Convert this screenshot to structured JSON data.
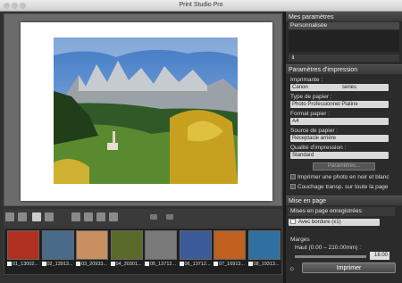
{
  "window": {
    "title": "Print Studio Pro"
  },
  "settings_panel": {
    "header": "Mes paramètres",
    "selected_preset": "Personnalisée"
  },
  "print_settings": {
    "header": "Paramètres d'impression",
    "printer_label": "Imprimante :",
    "printer_value_left": "Canon",
    "printer_value_right": "series",
    "paper_type_label": "Type de papier :",
    "paper_type_value": "Photo Professionnel Platine",
    "paper_size_label": "Format papier :",
    "paper_size_value": "A4",
    "paper_source_label": "Source de papier :",
    "paper_source_value": "Réceptacle arrière",
    "quality_label": "Qualité d'impression :",
    "quality_value": "Standard",
    "params_button": "Paramètres...",
    "bw_checkbox": "Imprimer une photo en noir et blanc",
    "coating_checkbox": "Couchage transp. sur toute la page"
  },
  "layout": {
    "header": "Mise en page",
    "saved_header": "Mises en page enregistrées",
    "layout_value": "Avec bordure (x1)",
    "margins_label": "Marges",
    "top_label": "Haut (0.00 – 210.00mm) :",
    "top_value": "18.00"
  },
  "print_button": "Imprimer",
  "thumbnails": [
    {
      "label": "01_13002...",
      "color": "#b03020"
    },
    {
      "label": "02_13913...",
      "color": "#4a6a8a"
    },
    {
      "label": "03_20933...",
      "color": "#c89060"
    },
    {
      "label": "04_30301...",
      "color": "#5a6a2a"
    },
    {
      "label": "05_13712...",
      "color": "#7a7a7a"
    },
    {
      "label": "06_13712...",
      "color": "#3a5a9a"
    },
    {
      "label": "07_16913...",
      "color": "#c06020"
    },
    {
      "label": "08_19313...",
      "color": "#3070a0"
    }
  ]
}
